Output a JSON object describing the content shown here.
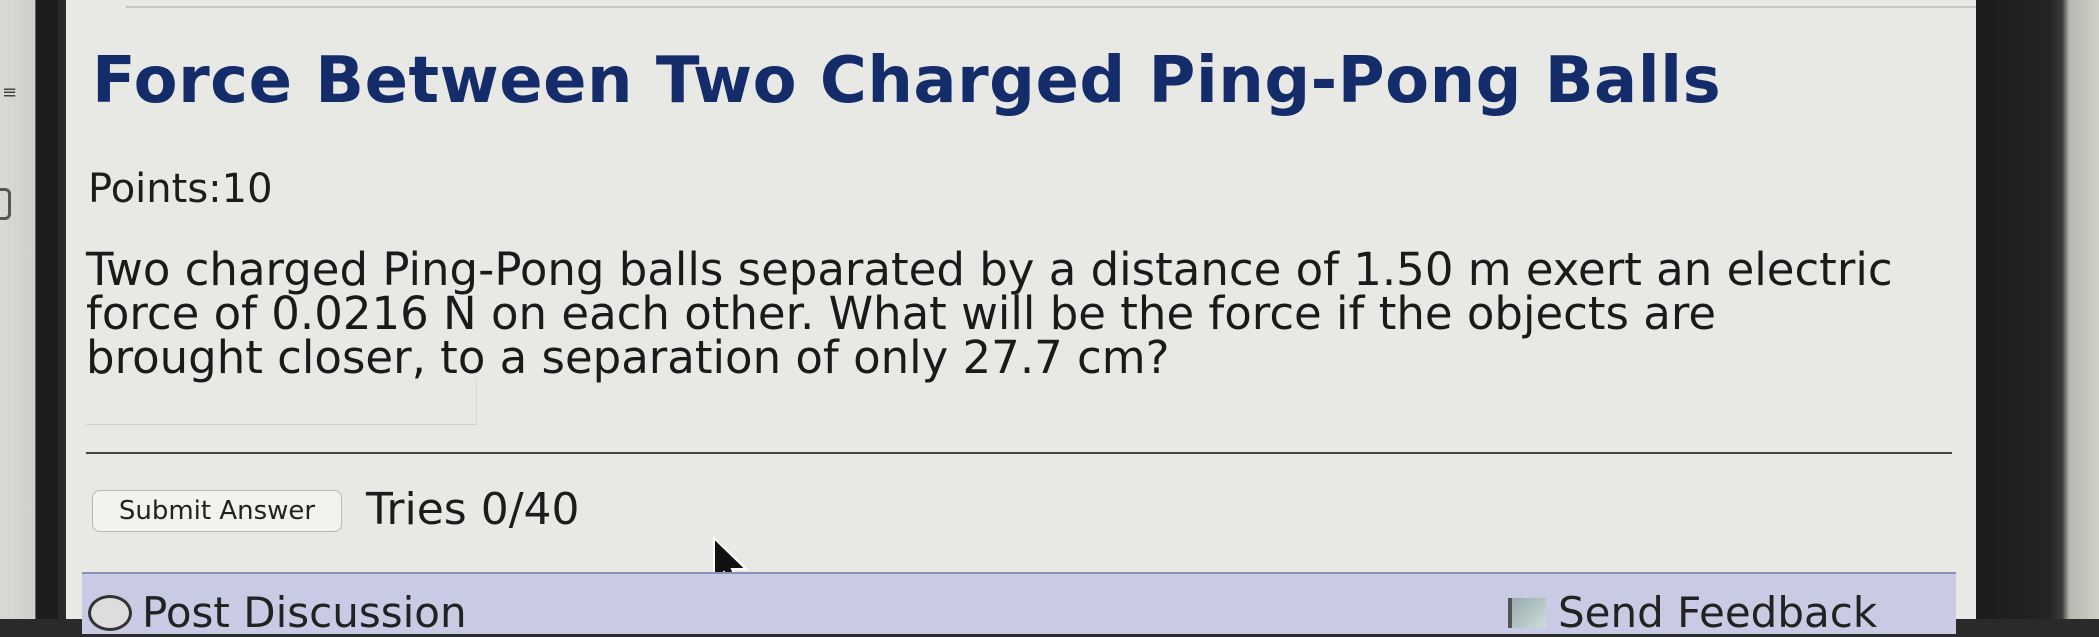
{
  "problem": {
    "title": "Force Between Two Charged Ping-Pong Balls",
    "points_label": "Points:10",
    "text_line1": "Two charged Ping-Pong balls separated by a distance of 1.50 m exert an electric",
    "text_line2": "force of 0.0216 N on each other. What will be the force if the objects are",
    "text_line3": "brought closer, to a separation of only 27.7 cm?",
    "answer_value": "",
    "answer_placeholder": ""
  },
  "actions": {
    "submit_label": "Submit Answer",
    "tries_label": "Tries 0/40"
  },
  "footer": {
    "discussion_label": "Post Discussion",
    "feedback_label": "Send Feedback"
  },
  "icons": {
    "menu": "menu-icon",
    "cursor": "mouse-pointer-icon",
    "discussion": "chat-bubble-icon",
    "feedback": "flag-icon"
  },
  "colors": {
    "title": "#142c6a",
    "footer_bar": "#c9cbe4",
    "page_background": "#e8e8e4"
  }
}
